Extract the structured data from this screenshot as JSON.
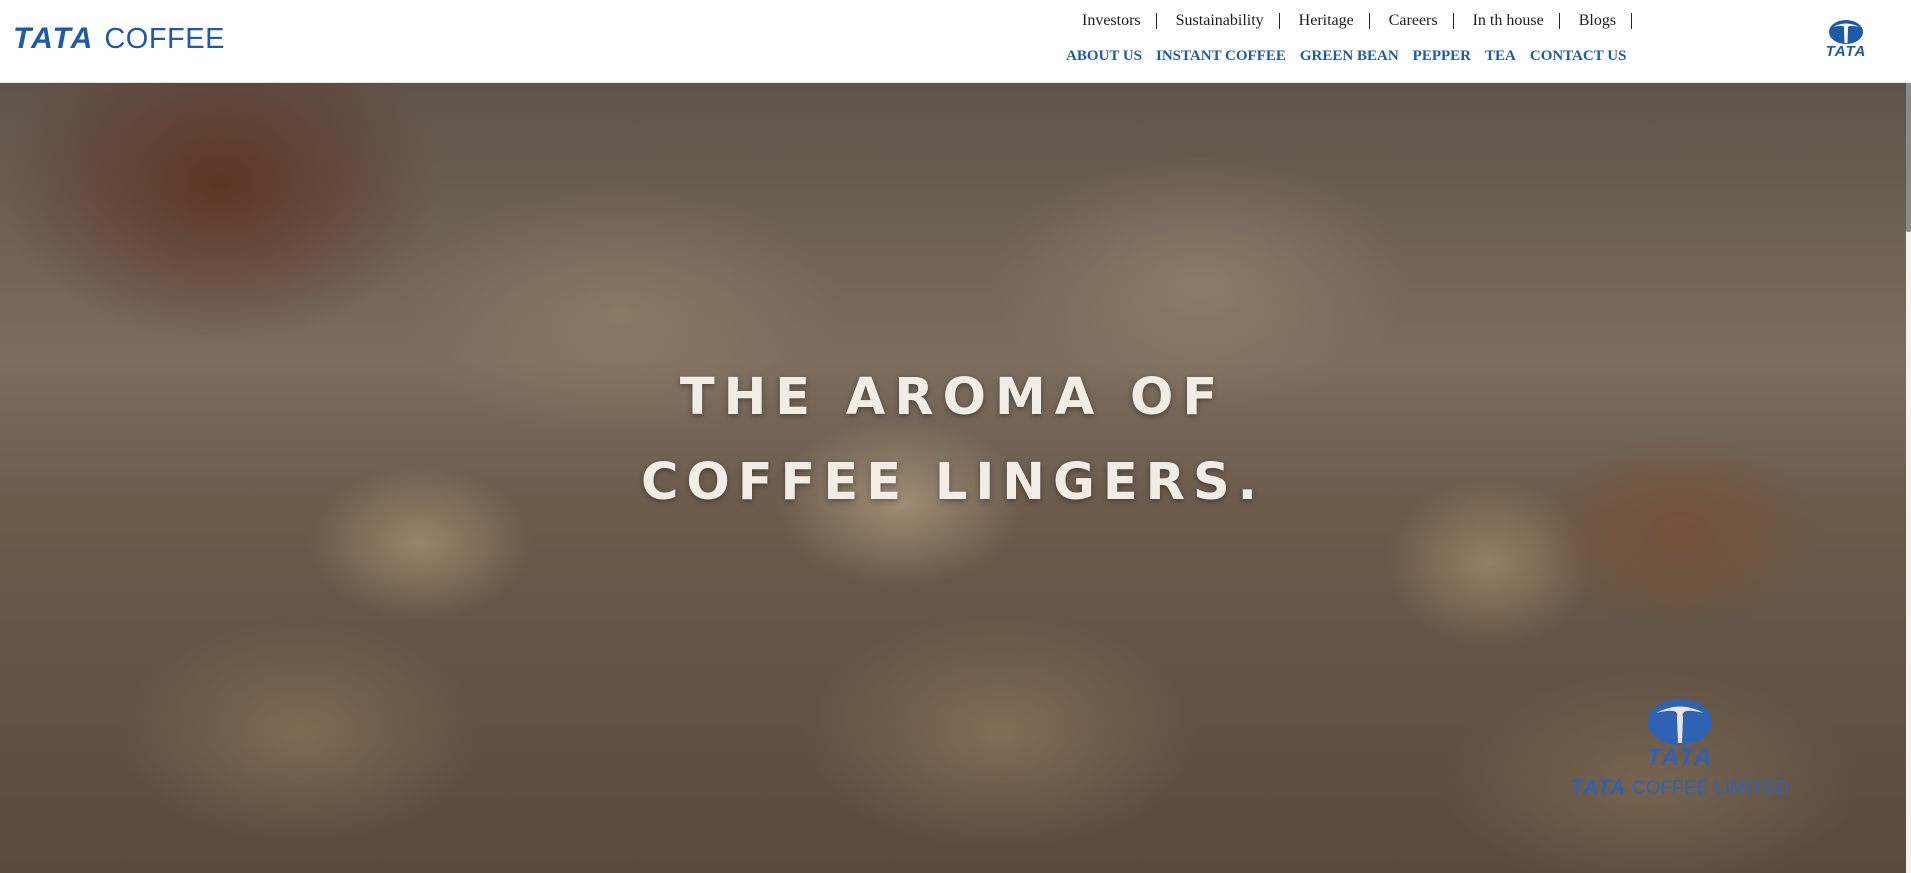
{
  "header": {
    "logo": {
      "brand": "TATA",
      "product": "COFFEE"
    },
    "top_links": [
      {
        "label": "Investors"
      },
      {
        "label": "Sustainability"
      },
      {
        "label": "Heritage"
      },
      {
        "label": "Careers"
      },
      {
        "label": "In th house"
      },
      {
        "label": "Blogs"
      }
    ],
    "main_nav": [
      {
        "label": "ABOUT US"
      },
      {
        "label": "INSTANT COFFEE"
      },
      {
        "label": "GREEN BEAN"
      },
      {
        "label": "PEPPER"
      },
      {
        "label": "TEA"
      },
      {
        "label": "CONTACT US"
      }
    ],
    "emblem_word": "TATA"
  },
  "hero": {
    "headline_line1": "THE AROMA OF",
    "headline_line2": "COFFEE LINGERS.",
    "logo_word": "TATA",
    "company_brand": "TATA",
    "company_name": "COFFEE LIMITED"
  },
  "colors": {
    "brand_blue": "#1e5aa8",
    "hero_logo_blue": "#2e62b4",
    "headline": "#f1ede6"
  }
}
